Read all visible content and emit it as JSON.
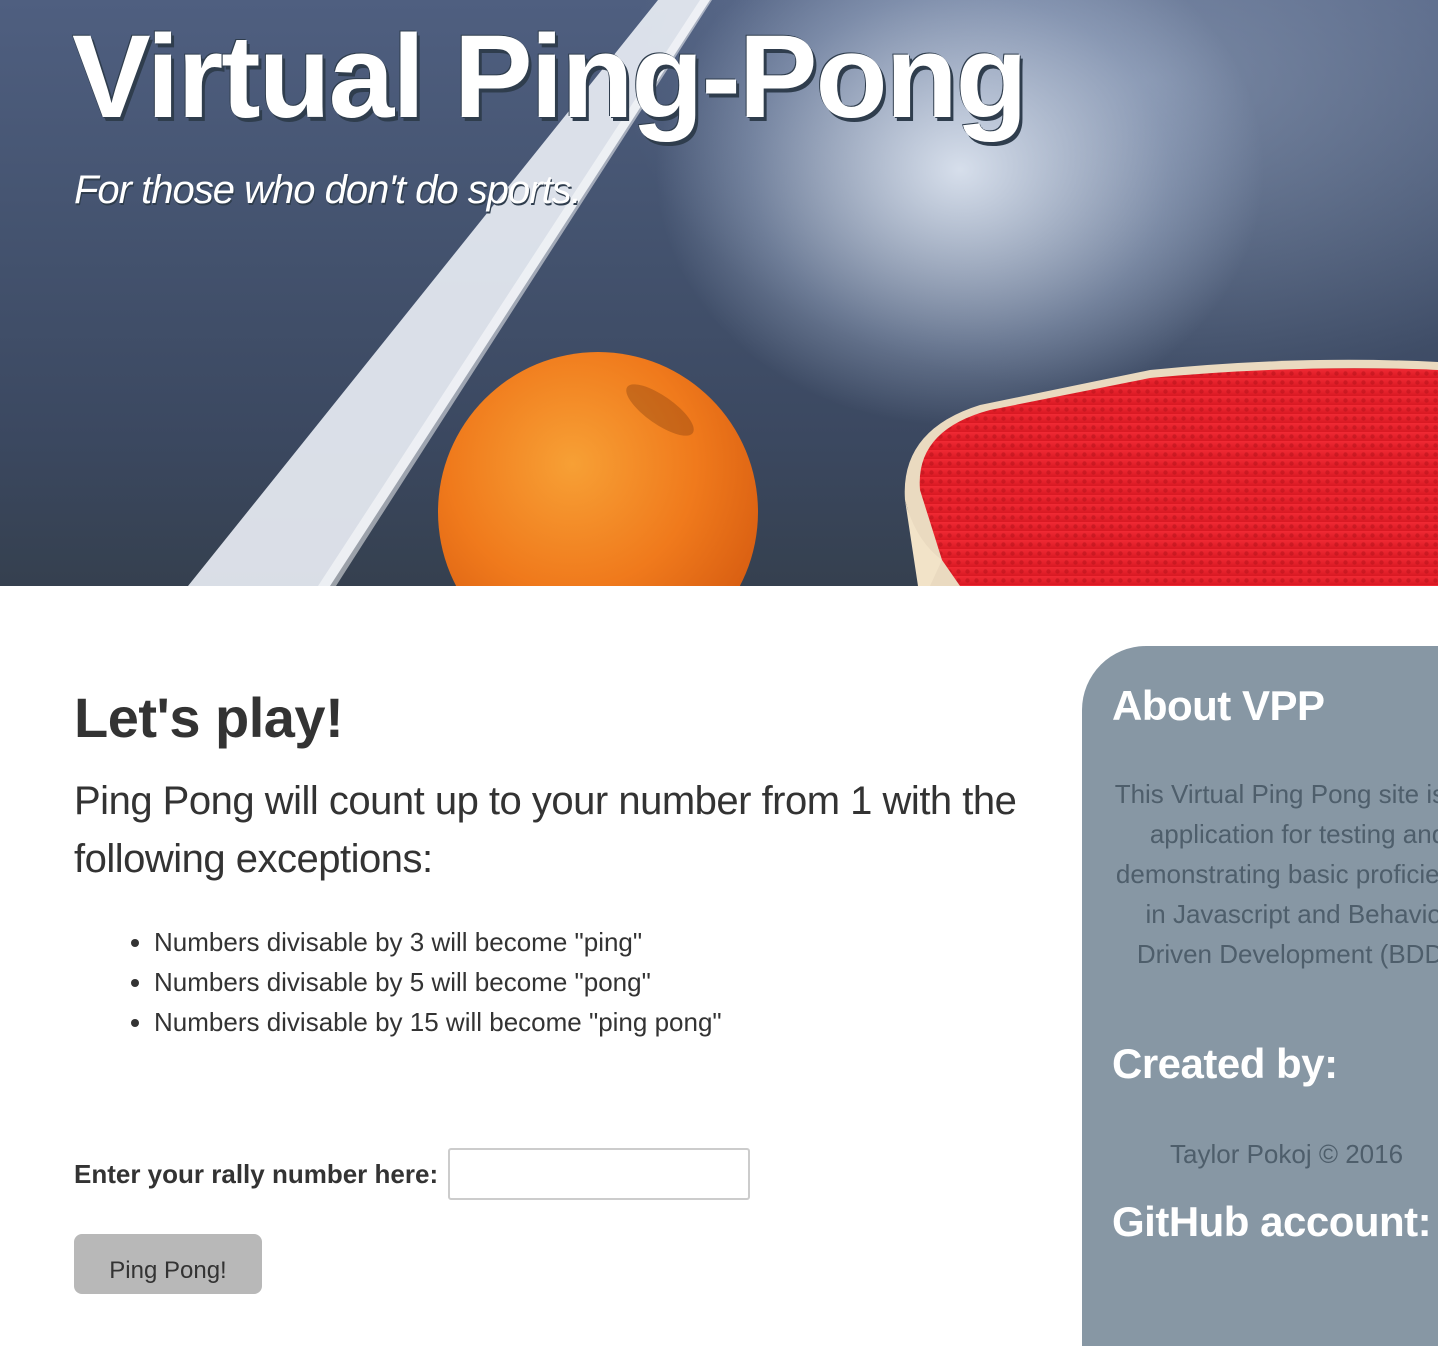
{
  "hero": {
    "title": "Virtual Ping-Pong",
    "subtitle": "For those who don't do sports."
  },
  "main": {
    "heading": "Let's play!",
    "lead": "Ping Pong will count up to your number from 1 with the following exceptions:",
    "rules": [
      "Numbers divisable by 3 will become \"ping\"",
      "Numbers divisable by 5 will become \"pong\"",
      "Numbers divisable by 15 will become \"ping pong\""
    ],
    "form": {
      "label": "Enter your rally number here:",
      "input_value": "",
      "button_label": "Ping Pong!"
    }
  },
  "sidebar": {
    "about_heading": "About VPP",
    "about_text": "This Virtual Ping Pong site is an application for testing and demonstrating basic proficiency in Javascript and Behavior Driven Development (BDD).",
    "created_heading": "Created by:",
    "created_text": "Taylor Pokoj © 2016",
    "github_heading": "GitHub account:"
  },
  "colors": {
    "sidebar_bg": "#8797a4",
    "sidebar_text": "#4e5e6b",
    "button_bg": "#b8b8b8",
    "ball": "#f07a1c",
    "paddle": "#e6202a"
  },
  "icons": [
    "ping-pong-ball-image",
    "paddle-image"
  ]
}
